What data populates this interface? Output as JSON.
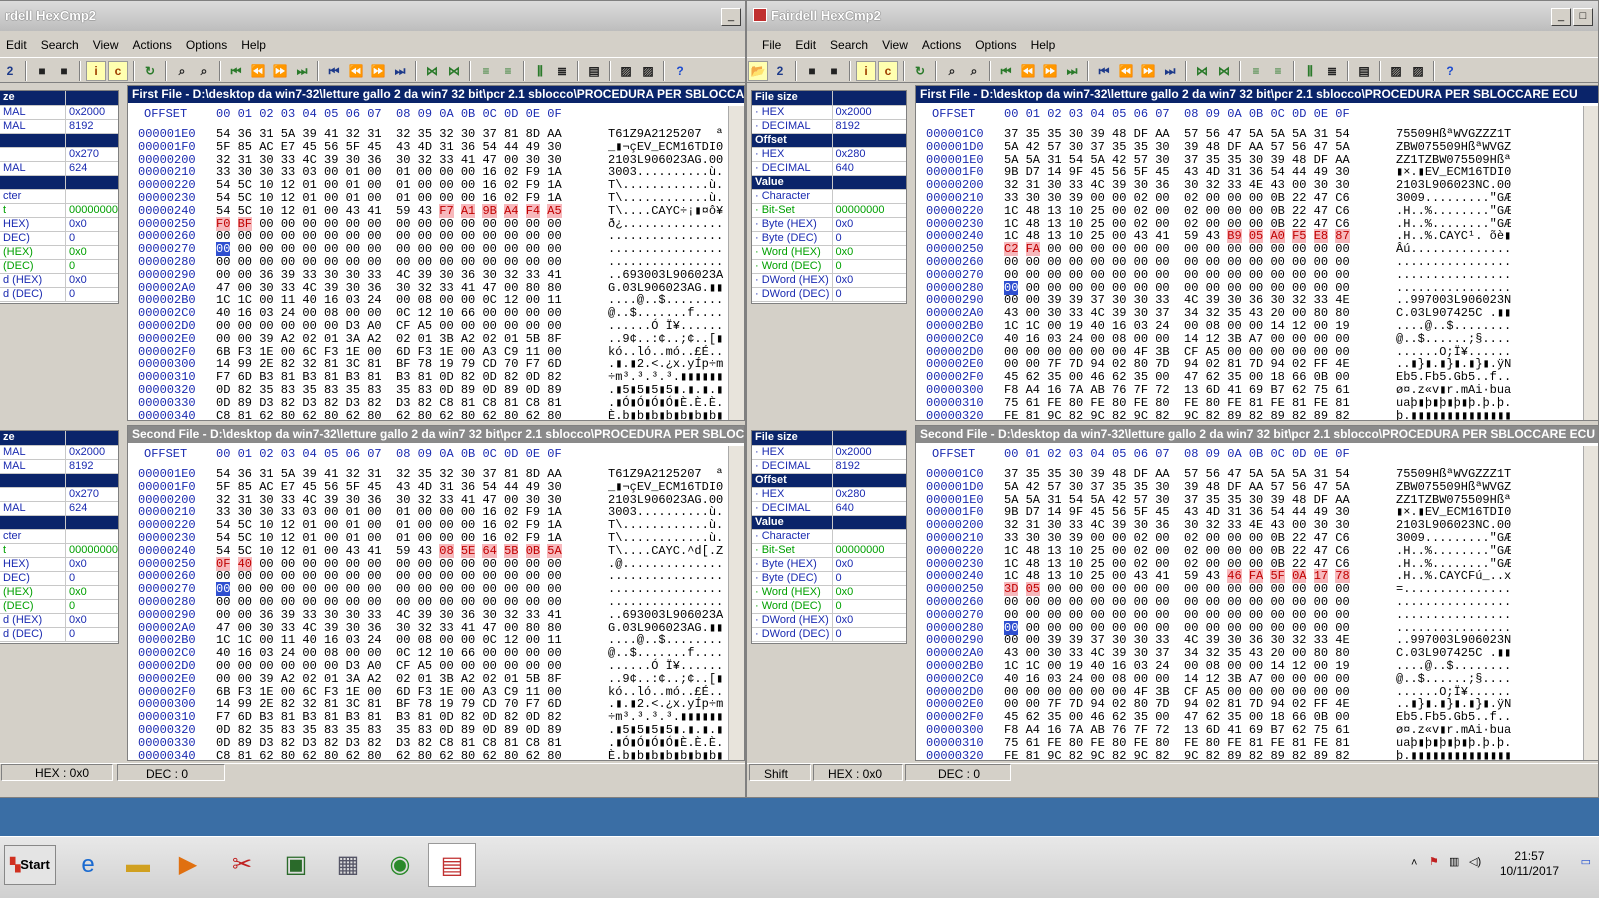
{
  "left_window": {
    "title": "rdell HexCmp2",
    "menu": [
      "Edit",
      "Search",
      "View",
      "Actions",
      "Options",
      "Help"
    ],
    "status": {
      "hex": "HEX : 0x0",
      "dec": "DEC : 0"
    },
    "info_top": [
      {
        "k": "ze",
        "v": "",
        "sec": true
      },
      {
        "k": "MAL",
        "v": "0x2000"
      },
      {
        "k": "MAL",
        "v": "8192"
      },
      {
        "k": "",
        "v": "",
        "sec": true
      },
      {
        "k": "",
        "v": "0x270"
      },
      {
        "k": "MAL",
        "v": "624"
      },
      {
        "k": "",
        "v": "",
        "sec": true
      },
      {
        "k": "cter",
        "v": ""
      },
      {
        "k": "t",
        "v": "00000000",
        "grn": true
      },
      {
        "k": "HEX)",
        "v": "0x0"
      },
      {
        "k": "DEC)",
        "v": "0"
      },
      {
        "k": "(HEX)",
        "v": "0x0",
        "grn": true
      },
      {
        "k": "(DEC)",
        "v": "0",
        "grn": true
      },
      {
        "k": "d (HEX)",
        "v": "0x0"
      },
      {
        "k": "d (DEC)",
        "v": "0"
      }
    ],
    "info_bottom": [
      {
        "k": "ze",
        "v": "",
        "sec": true
      },
      {
        "k": "MAL",
        "v": "0x2000"
      },
      {
        "k": "MAL",
        "v": "8192"
      },
      {
        "k": "",
        "v": "",
        "sec": true
      },
      {
        "k": "",
        "v": "0x270"
      },
      {
        "k": "MAL",
        "v": "624"
      },
      {
        "k": "",
        "v": "",
        "sec": true
      },
      {
        "k": "cter",
        "v": ""
      },
      {
        "k": "t",
        "v": "00000000",
        "grn": true
      },
      {
        "k": "HEX)",
        "v": "0x0"
      },
      {
        "k": "DEC)",
        "v": "0"
      },
      {
        "k": "(HEX)",
        "v": "0x0",
        "grn": true
      },
      {
        "k": "(DEC)",
        "v": "0",
        "grn": true
      },
      {
        "k": "d (HEX)",
        "v": "0x0"
      },
      {
        "k": "d (DEC)",
        "v": "0"
      }
    ],
    "hex_top": {
      "title": "First File - D:\\desktop da win7-32\\letture gallo 2 da win7 32 bit\\pcr 2.1 sblocco\\PROCEDURA PER SBLOCCA",
      "rows": [
        [
          "000001E0",
          "54 36 31 5A 39 41 32 31  32 35 32 30 37 81 8D AA",
          "T61Z9A2125207  ª"
        ],
        [
          "000001F0",
          "5F 85 AC E7 45 56 5F 45  43 4D 31 36 54 44 49 30",
          "_▮¬çEV_ECM16TDI0"
        ],
        [
          "00000200",
          "32 31 30 33 4C 39 30 36  30 32 33 41 47 00 30 30",
          "2103L906023AG.00"
        ],
        [
          "00000210",
          "33 30 30 33 03 00 01 00  01 00 00 00 16 02 F9 1A",
          "3003..........ù."
        ],
        [
          "00000220",
          "54 5C 10 12 01 00 01 00  01 00 00 00 16 02 F9 1A",
          "T\\............ù."
        ],
        [
          "00000230",
          "54 5C 10 12 01 00 01 00  01 00 00 00 16 02 F9 1A",
          "T\\............ù."
        ],
        [
          "00000240",
          "54 5C 10 12 01 00 43 41  59 43 F7 A1 9B A4 F4 A5",
          "T\\....CAYC÷¡▮¤ô¥"
        ],
        [
          "00000250",
          "F0 BF 00 00 00 00 00 00  00 00 00 00 00 00 00 00",
          "ð¿.............."
        ],
        [
          "00000260",
          "00 00 00 00 00 00 00 00  00 00 00 00 00 00 00 00",
          "................"
        ],
        [
          "00000270",
          "00 00 00 00 00 00 00 00  00 00 00 00 00 00 00 00",
          "................"
        ],
        [
          "00000280",
          "00 00 00 00 00 00 00 00  00 00 00 00 00 00 00 00",
          "................"
        ],
        [
          "00000290",
          "00 00 36 39 33 30 30 33  4C 39 30 36 30 32 33 41",
          "..693003L906023A"
        ],
        [
          "000002A0",
          "47 00 30 33 4C 39 30 36  30 32 33 41 47 00 80 80",
          "G.03L906023AG.▮▮"
        ],
        [
          "000002B0",
          "1C 1C 00 11 40 16 03 24  00 08 00 00 0C 12 00 11",
          "....@..$........"
        ],
        [
          "000002C0",
          "40 16 03 24 00 08 00 00  0C 12 10 66 00 00 00 00",
          "@..$.......f...."
        ],
        [
          "000002D0",
          "00 00 00 00 00 00 D3 A0  CF A5 00 00 00 00 00 00",
          "......Ó Ï¥......"
        ],
        [
          "000002E0",
          "00 00 39 A2 02 01 3A A2  02 01 3B A2 02 01 5B 8F",
          "..9¢..:¢..;¢..[▮"
        ],
        [
          "000002F0",
          "6B F3 1E 00 6C F3 1E 00  6D F3 1E 00 A3 C9 11 00",
          "kó..ló..mó..£É.."
        ],
        [
          "00000300",
          "14 99 2E 82 32 81 3C 81  BF 78 19 79 CD 70 F7 6D",
          ".▮.▮2.<.¿x.yÍp÷m"
        ],
        [
          "00000310",
          "F7 6D B3 81 B3 81 B3 81  B3 81 0D 82 0D 82 0D 82",
          "÷m³.³.³.³.▮▮▮▮▮▮"
        ],
        [
          "00000320",
          "0D 82 35 83 35 83 35 83  35 83 0D 89 0D 89 0D 89",
          ".▮5▮5▮5▮5▮.▮.▮.▮"
        ],
        [
          "00000330",
          "0D 89 D3 82 D3 82 D3 82  D3 82 C8 81 C8 81 C8 81",
          ".▮Ó▮Ó▮Ó▮Ó▮È.È.È."
        ],
        [
          "00000340",
          "C8 81 62 80 62 80 62 80  62 80 62 80 62 80 62 80",
          "È.b▮b▮b▮b▮b▮b▮b▮"
        ]
      ],
      "diff": {
        "6": [
          10,
          11,
          12,
          13,
          14,
          15
        ],
        "7": [
          0,
          1
        ]
      },
      "cur": {
        "row": 9,
        "col": 0
      }
    },
    "hex_bottom": {
      "title": "Second File - D:\\desktop da win7-32\\letture gallo 2 da win7 32 bit\\pcr 2.1 sblocco\\PROCEDURA PER SBLOCCA",
      "rows": [
        [
          "000001E0",
          "54 36 31 5A 39 41 32 31  32 35 32 30 37 81 8D AA",
          "T61Z9A2125207  ª"
        ],
        [
          "000001F0",
          "5F 85 AC E7 45 56 5F 45  43 4D 31 36 54 44 49 30",
          "_▮¬çEV_ECM16TDI0"
        ],
        [
          "00000200",
          "32 31 30 33 4C 39 30 36  30 32 33 41 47 00 30 30",
          "2103L906023AG.00"
        ],
        [
          "00000210",
          "33 30 30 33 03 00 01 00  01 00 00 00 16 02 F9 1A",
          "3003..........ù."
        ],
        [
          "00000220",
          "54 5C 10 12 01 00 01 00  01 00 00 00 16 02 F9 1A",
          "T\\............ù."
        ],
        [
          "00000230",
          "54 5C 10 12 01 00 01 00  01 00 00 00 16 02 F9 1A",
          "T\\............ù."
        ],
        [
          "00000240",
          "54 5C 10 12 01 00 43 41  59 43 08 5E 64 5B 0B 5A",
          "T\\....CAYC.^d[.Z"
        ],
        [
          "00000250",
          "0F 40 00 00 00 00 00 00  00 00 00 00 00 00 00 00",
          ".@.............."
        ],
        [
          "00000260",
          "00 00 00 00 00 00 00 00  00 00 00 00 00 00 00 00",
          "................"
        ],
        [
          "00000270",
          "00 00 00 00 00 00 00 00  00 00 00 00 00 00 00 00",
          "................"
        ],
        [
          "00000280",
          "00 00 00 00 00 00 00 00  00 00 00 00 00 00 00 00",
          "................"
        ],
        [
          "00000290",
          "00 00 36 39 33 30 30 33  4C 39 30 36 30 32 33 41",
          "..693003L906023A"
        ],
        [
          "000002A0",
          "47 00 30 33 4C 39 30 36  30 32 33 41 47 00 80 80",
          "G.03L906023AG.▮▮"
        ],
        [
          "000002B0",
          "1C 1C 00 11 40 16 03 24  00 08 00 00 0C 12 00 11",
          "....@..$........"
        ],
        [
          "000002C0",
          "40 16 03 24 00 08 00 00  0C 12 10 66 00 00 00 00",
          "@..$.......f...."
        ],
        [
          "000002D0",
          "00 00 00 00 00 00 D3 A0  CF A5 00 00 00 00 00 00",
          "......Ó Ï¥......"
        ],
        [
          "000002E0",
          "00 00 39 A2 02 01 3A A2  02 01 3B A2 02 01 5B 8F",
          "..9¢..:¢..;¢..[▮"
        ],
        [
          "000002F0",
          "6B F3 1E 00 6C F3 1E 00  6D F3 1E 00 A3 C9 11 00",
          "kó..ló..mó..£É.."
        ],
        [
          "00000300",
          "14 99 2E 82 32 81 3C 81  BF 78 19 79 CD 70 F7 6D",
          ".▮.▮2.<.¿x.yÍp÷m"
        ],
        [
          "00000310",
          "F7 6D B3 81 B3 81 B3 81  B3 81 0D 82 0D 82 0D 82",
          "÷m³.³.³.³.▮▮▮▮▮▮"
        ],
        [
          "00000320",
          "0D 82 35 83 35 83 35 83  35 83 0D 89 0D 89 0D 89",
          ".▮5▮5▮5▮5▮.▮.▮.▮"
        ],
        [
          "00000330",
          "0D 89 D3 82 D3 82 D3 82  D3 82 C8 81 C8 81 C8 81",
          ".▮Ó▮Ó▮Ó▮Ó▮È.È.È."
        ],
        [
          "00000340",
          "C8 81 62 80 62 80 62 80  62 80 62 80 62 80 62 80",
          "È.b▮b▮b▮b▮b▮b▮b▮"
        ]
      ],
      "diff": {
        "6": [
          10,
          11,
          12,
          13,
          14,
          15
        ],
        "7": [
          0,
          1
        ]
      },
      "cur": {
        "row": 9,
        "col": 0
      }
    }
  },
  "right_window": {
    "title": "Fairdell HexCmp2",
    "menu": [
      "File",
      "Edit",
      "Search",
      "View",
      "Actions",
      "Options",
      "Help"
    ],
    "status": {
      "shift": "Shift",
      "hex": "HEX : 0x0",
      "dec": "DEC : 0"
    },
    "info_top": [
      {
        "k": "File size",
        "v": "",
        "sec": true
      },
      {
        "k": "· HEX",
        "v": "0x2000"
      },
      {
        "k": "· DECIMAL",
        "v": "8192"
      },
      {
        "k": "Offset",
        "v": "",
        "sec": true
      },
      {
        "k": "· HEX",
        "v": "0x280"
      },
      {
        "k": "· DECIMAL",
        "v": "640"
      },
      {
        "k": "Value",
        "v": "",
        "sec": true
      },
      {
        "k": "· Character",
        "v": ""
      },
      {
        "k": "· Bit-Set",
        "v": "00000000",
        "grn": true
      },
      {
        "k": "· Byte (HEX)",
        "v": "0x0"
      },
      {
        "k": "· Byte (DEC)",
        "v": "0"
      },
      {
        "k": "· Word (HEX)",
        "v": "0x0",
        "grn": true
      },
      {
        "k": "· Word (DEC)",
        "v": "0",
        "grn": true
      },
      {
        "k": "· DWord (HEX)",
        "v": "0x0"
      },
      {
        "k": "· DWord (DEC)",
        "v": "0"
      }
    ],
    "info_bottom": [
      {
        "k": "File size",
        "v": "",
        "sec": true
      },
      {
        "k": "· HEX",
        "v": "0x2000"
      },
      {
        "k": "· DECIMAL",
        "v": "8192"
      },
      {
        "k": "Offset",
        "v": "",
        "sec": true
      },
      {
        "k": "· HEX",
        "v": "0x280"
      },
      {
        "k": "· DECIMAL",
        "v": "640"
      },
      {
        "k": "Value",
        "v": "",
        "sec": true
      },
      {
        "k": "· Character",
        "v": ""
      },
      {
        "k": "· Bit-Set",
        "v": "00000000",
        "grn": true
      },
      {
        "k": "· Byte (HEX)",
        "v": "0x0"
      },
      {
        "k": "· Byte (DEC)",
        "v": "0"
      },
      {
        "k": "· Word (HEX)",
        "v": "0x0",
        "grn": true
      },
      {
        "k": "· Word (DEC)",
        "v": "0",
        "grn": true
      },
      {
        "k": "· DWord (HEX)",
        "v": "0x0"
      },
      {
        "k": "· DWord (DEC)",
        "v": "0"
      }
    ],
    "hex_top": {
      "title": "First File - D:\\desktop da win7-32\\letture gallo 2 da win7 32 bit\\pcr 2.1 sblocco\\PROCEDURA PER SBLOCCARE ECU",
      "rows": [
        [
          "000001C0",
          "37 35 35 30 39 48 DF AA  57 56 47 5A 5A 5A 31 54",
          "75509HßªWVGZZZ1T"
        ],
        [
          "000001D0",
          "5A 42 57 30 37 35 35 30  39 48 DF AA 57 56 47 5A",
          "ZBW075509HßªWVGZ"
        ],
        [
          "000001E0",
          "5A 5A 31 54 5A 42 57 30  37 35 35 30 39 48 DF AA",
          "ZZ1TZBW075509Hßª"
        ],
        [
          "000001F0",
          "9B D7 14 9F 45 56 5F 45  43 4D 31 36 54 44 49 30",
          "▮×.▮EV_ECM16TDI0"
        ],
        [
          "00000200",
          "32 31 30 33 4C 39 30 36  30 32 33 4E 43 00 30 30",
          "2103L906023NC.00"
        ],
        [
          "00000210",
          "33 30 30 39 00 00 02 00  02 00 00 00 0B 22 47 C6",
          "3009.........\"GÆ"
        ],
        [
          "00000220",
          "1C 48 13 10 25 00 02 00  02 00 00 00 0B 22 47 C6",
          ".H..%........\"GÆ"
        ],
        [
          "00000230",
          "1C 48 13 10 25 00 02 00  02 00 00 00 0B 22 47 C6",
          ".H..%........\"GÆ"
        ],
        [
          "00000240",
          "1C 48 13 10 25 00 43 41  59 43 B9 05 A0 F5 E8 87",
          ".H..%.CAYC¹. õè▮"
        ],
        [
          "00000250",
          "C2 FA 00 00 00 00 00 00  00 00 00 00 00 00 00 00",
          "Âú.............."
        ],
        [
          "00000260",
          "00 00 00 00 00 00 00 00  00 00 00 00 00 00 00 00",
          "................"
        ],
        [
          "00000270",
          "00 00 00 00 00 00 00 00  00 00 00 00 00 00 00 00",
          "................"
        ],
        [
          "00000280",
          "00 00 00 00 00 00 00 00  00 00 00 00 00 00 00 00",
          "................"
        ],
        [
          "00000290",
          "00 00 39 39 37 30 30 33  4C 39 30 36 30 32 33 4E",
          "..997003L906023N"
        ],
        [
          "000002A0",
          "43 00 30 33 4C 39 30 37  34 32 35 43 20 00 80 80",
          "C.03L907425C .▮▮"
        ],
        [
          "000002B0",
          "1C 1C 00 19 40 16 03 24  00 08 00 00 14 12 00 19",
          "....@..$........"
        ],
        [
          "000002C0",
          "40 16 03 24 00 08 00 00  14 12 3B A7 00 00 00 00",
          "@..$......;§...."
        ],
        [
          "000002D0",
          "00 00 00 00 00 00 4F 3B  CF A5 00 00 00 00 00 00",
          "......O;Ï¥......"
        ],
        [
          "000002E0",
          "00 00 7F 7D 94 02 80 7D  94 02 81 7D 94 02 FF 4E",
          "..▮}▮.▮}▮.▮}▮.ÿN"
        ],
        [
          "000002F0",
          "45 62 35 00 46 62 35 00  47 62 35 00 18 66 0B 00",
          "Eb5.Fb5.Gb5..f.."
        ],
        [
          "00000300",
          "F8 A4 16 7A AB 76 7F 72  13 6D 41 69 B7 62 75 61",
          "ø¤.z«v▮r.mAi·bua"
        ],
        [
          "00000310",
          "75 61 FE 80 FE 80 FE 80  FE 80 FE 81 FE 81 FE 81",
          "uaþ▮þ▮þ▮þ▮þ.þ.þ."
        ],
        [
          "00000320",
          "FE 81 9C 82 9C 82 9C 82  9C 82 89 82 89 82 89 82",
          "þ.▮▮▮▮▮▮▮▮▮▮▮▮▮▮"
        ]
      ],
      "diff": {
        "8": [
          10,
          11,
          12,
          13,
          14,
          15
        ],
        "9": [
          0,
          1
        ]
      },
      "cur": {
        "row": 12,
        "col": 0
      }
    },
    "hex_bottom": {
      "title": "Second File - D:\\desktop da win7-32\\letture gallo 2 da win7 32 bit\\pcr 2.1 sblocco\\PROCEDURA PER SBLOCCARE ECU",
      "rows": [
        [
          "000001C0",
          "37 35 35 30 39 48 DF AA  57 56 47 5A 5A 5A 31 54",
          "75509HßªWVGZZZ1T"
        ],
        [
          "000001D0",
          "5A 42 57 30 37 35 35 30  39 48 DF AA 57 56 47 5A",
          "ZBW075509HßªWVGZ"
        ],
        [
          "000001E0",
          "5A 5A 31 54 5A 42 57 30  37 35 35 30 39 48 DF AA",
          "ZZ1TZBW075509Hßª"
        ],
        [
          "000001F0",
          "9B D7 14 9F 45 56 5F 45  43 4D 31 36 54 44 49 30",
          "▮×.▮EV_ECM16TDI0"
        ],
        [
          "00000200",
          "32 31 30 33 4C 39 30 36  30 32 33 4E 43 00 30 30",
          "2103L906023NC.00"
        ],
        [
          "00000210",
          "33 30 30 39 00 00 02 00  02 00 00 00 0B 22 47 C6",
          "3009.........\"GÆ"
        ],
        [
          "00000220",
          "1C 48 13 10 25 00 02 00  02 00 00 00 0B 22 47 C6",
          ".H..%........\"GÆ"
        ],
        [
          "00000230",
          "1C 48 13 10 25 00 02 00  02 00 00 00 0B 22 47 C6",
          ".H..%........\"GÆ"
        ],
        [
          "00000240",
          "1C 48 13 10 25 00 43 41  59 43 46 FA 5F 0A 17 78",
          ".H..%.CAYCFú_..x"
        ],
        [
          "00000250",
          "3D 05 00 00 00 00 00 00  00 00 00 00 00 00 00 00",
          "=..............."
        ],
        [
          "00000260",
          "00 00 00 00 00 00 00 00  00 00 00 00 00 00 00 00",
          "................"
        ],
        [
          "00000270",
          "00 00 00 00 00 00 00 00  00 00 00 00 00 00 00 00",
          "................"
        ],
        [
          "00000280",
          "00 00 00 00 00 00 00 00  00 00 00 00 00 00 00 00",
          "................"
        ],
        [
          "00000290",
          "00 00 39 39 37 30 30 33  4C 39 30 36 30 32 33 4E",
          "..997003L906023N"
        ],
        [
          "000002A0",
          "43 00 30 33 4C 39 30 37  34 32 35 43 20 00 80 80",
          "C.03L907425C .▮▮"
        ],
        [
          "000002B0",
          "1C 1C 00 19 40 16 03 24  00 08 00 00 14 12 00 19",
          "....@..$........"
        ],
        [
          "000002C0",
          "40 16 03 24 00 08 00 00  14 12 3B A7 00 00 00 00",
          "@..$......;§...."
        ],
        [
          "000002D0",
          "00 00 00 00 00 00 4F 3B  CF A5 00 00 00 00 00 00",
          "......O;Ï¥......"
        ],
        [
          "000002E0",
          "00 00 7F 7D 94 02 80 7D  94 02 81 7D 94 02 FF 4E",
          "..▮}▮.▮}▮.▮}▮.ÿN"
        ],
        [
          "000002F0",
          "45 62 35 00 46 62 35 00  47 62 35 00 18 66 0B 00",
          "Eb5.Fb5.Gb5..f.."
        ],
        [
          "00000300",
          "F8 A4 16 7A AB 76 7F 72  13 6D 41 69 B7 62 75 61",
          "ø¤.z«v▮r.mAi·bua"
        ],
        [
          "00000310",
          "75 61 FE 80 FE 80 FE 80  FE 80 FE 81 FE 81 FE 81",
          "uaþ▮þ▮þ▮þ▮þ.þ.þ."
        ],
        [
          "00000320",
          "FE 81 9C 82 9C 82 9C 82  9C 82 89 82 89 82 89 82",
          "þ.▮▮▮▮▮▮▮▮▮▮▮▮▮▮"
        ]
      ],
      "diff": {
        "8": [
          10,
          11,
          12,
          13,
          14,
          15
        ],
        "9": [
          0,
          1
        ]
      },
      "cur": {
        "row": 12,
        "col": 0
      }
    }
  },
  "hex_header": {
    "offset": "OFFSET",
    "cols": "00 01 02 03 04 05 06 07  08 09 0A 0B 0C 0D 0E 0F"
  },
  "taskbar": {
    "start": "Start",
    "time": "21:57",
    "date": "10/11/2017"
  },
  "colors": {
    "desktop": "#3a6ea5",
    "diff": "#f7b8bc",
    "active_title": "#0a246a"
  }
}
